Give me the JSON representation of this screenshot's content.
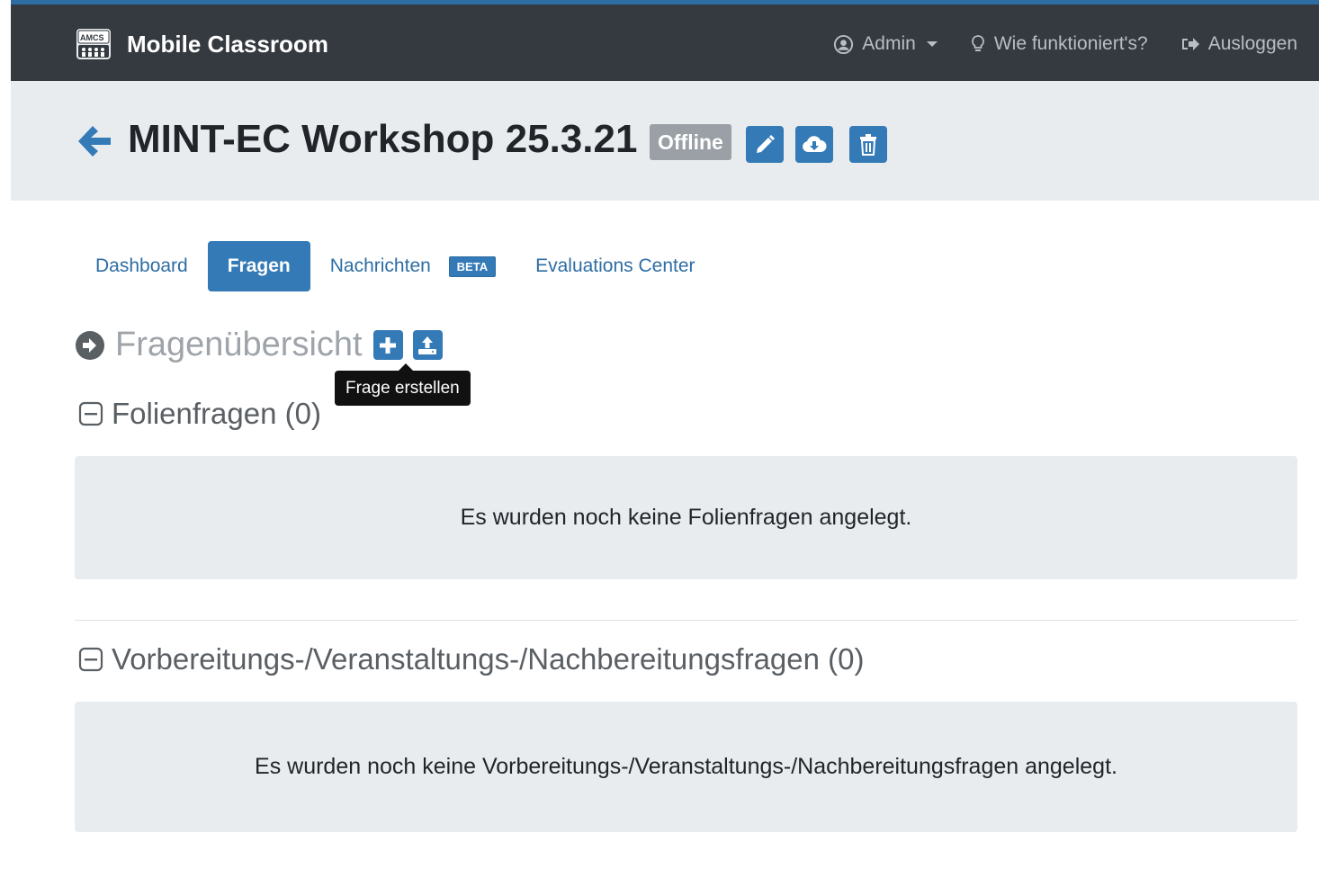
{
  "navbar": {
    "brand": "Mobile Classroom",
    "brand_logo_text": "AMCS",
    "user_menu": "Admin",
    "help_link": "Wie funktioniert's?",
    "logout_link": "Ausloggen"
  },
  "header": {
    "title": "MINT-EC Workshop 25.3.21",
    "status_badge": "Offline"
  },
  "tabs": [
    {
      "label": "Dashboard",
      "active": false
    },
    {
      "label": "Fragen",
      "active": true
    },
    {
      "label": "Nachrichten",
      "active": false,
      "badge": "BETA"
    },
    {
      "label": "Evaluations Center",
      "active": false
    }
  ],
  "overview": {
    "title": "Fragenübersicht",
    "tooltip": "Frage erstellen"
  },
  "groups": [
    {
      "title": "Folienfragen (0)",
      "empty_text": "Es wurden noch keine Folienfragen angelegt."
    },
    {
      "title": "Vorbereitungs-/Veranstaltungs-/Nachbereitungsfragen (0)",
      "empty_text": "Es wurden noch keine Vorbereitungs-/Veranstaltungs-/Nachbereitungsfragen angelegt."
    }
  ],
  "colors": {
    "navbar": "#343a40",
    "primary": "#337ab7",
    "header_bg": "#e9ecef",
    "badge_gray": "#9aa0a6"
  },
  "icons": {
    "back": "arrow-left-icon",
    "edit": "pencil-icon",
    "download": "cloud-download-icon",
    "delete": "trash-icon",
    "add": "plus-square-icon",
    "upload": "upload-icon",
    "collapse": "minus-square-icon"
  }
}
